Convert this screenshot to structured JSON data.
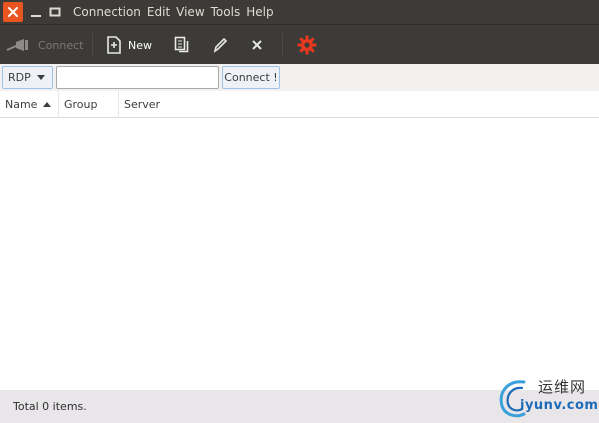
{
  "window": {
    "controls": {
      "close_icon": "close-icon",
      "minimize_icon": "minimize-icon",
      "maximize_icon": "maximize-icon"
    },
    "accent_color": "#e95420"
  },
  "menubar": {
    "items": [
      {
        "label": "Connection"
      },
      {
        "label": "Edit"
      },
      {
        "label": "View"
      },
      {
        "label": "Tools"
      },
      {
        "label": "Help"
      }
    ]
  },
  "toolbar": {
    "connect": {
      "label": "Connect",
      "icon": "plug-icon",
      "enabled": false
    },
    "new": {
      "label": "New",
      "icon": "new-document-icon"
    },
    "copy": {
      "icon": "copy-icon"
    },
    "edit": {
      "icon": "pencil-icon"
    },
    "delete": {
      "icon": "close-icon"
    },
    "preferences": {
      "icon": "gear-icon",
      "color": "#e6391f"
    }
  },
  "quickconnect": {
    "protocol": "RDP",
    "server_value": "",
    "connect_label": "Connect !"
  },
  "table": {
    "columns": [
      {
        "label": "Name",
        "sorted": "ascending"
      },
      {
        "label": "Group"
      },
      {
        "label": "Server"
      }
    ],
    "rows": []
  },
  "status": {
    "text": "Total 0 items."
  },
  "watermark": {
    "cn": "运维网",
    "en": "iyunv.com"
  }
}
